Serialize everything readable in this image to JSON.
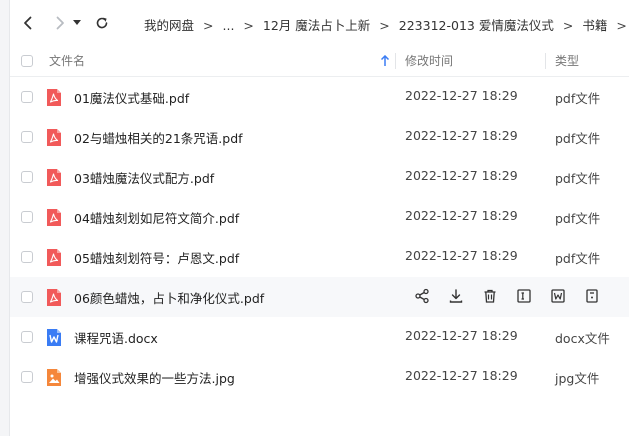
{
  "breadcrumb": {
    "items": [
      "我的网盘",
      "...",
      "12月 魔法占卜上新",
      "223312-013 爱情魔法仪式",
      "书籍"
    ],
    "separator": ">"
  },
  "columns": {
    "name": "文件名",
    "modified": "修改时间",
    "type": "类型"
  },
  "files": [
    {
      "name": "01魔法仪式基础.pdf",
      "date": "2022-12-27 18:29",
      "type": "pdf文件",
      "icon": "pdf-icon"
    },
    {
      "name": "02与蜡烛相关的21条咒语.pdf",
      "date": "2022-12-27 18:29",
      "type": "pdf文件",
      "icon": "pdf-icon"
    },
    {
      "name": "03蜡烛魔法仪式配方.pdf",
      "date": "2022-12-27 18:29",
      "type": "pdf文件",
      "icon": "pdf-icon"
    },
    {
      "name": "04蜡烛刻划如尼符文简介.pdf",
      "date": "2022-12-27 18:29",
      "type": "pdf文件",
      "icon": "pdf-icon"
    },
    {
      "name": "05蜡烛刻划符号：卢恩文.pdf",
      "date": "2022-12-27 18:29",
      "type": "pdf文件",
      "icon": "pdf-icon"
    },
    {
      "name": "06颜色蜡烛，占卜和净化仪式.pdf",
      "date": "",
      "type": "",
      "icon": "pdf-icon"
    },
    {
      "name": "课程咒语.docx",
      "date": "2022-12-27 18:29",
      "type": "docx文件",
      "icon": "word-icon"
    },
    {
      "name": "增强仪式效果的一些方法.jpg",
      "date": "2022-12-27 18:29",
      "type": "jpg文件",
      "icon": "image-icon"
    }
  ],
  "hover_actions": [
    "share-icon",
    "download-icon",
    "delete-icon",
    "rename-icon",
    "word-icon",
    "more-icon"
  ],
  "colors": {
    "pdf": "#f15a5a",
    "word": "#3a7cf4",
    "image": "#f5873b",
    "sort_arrow": "#3a7cf4"
  }
}
